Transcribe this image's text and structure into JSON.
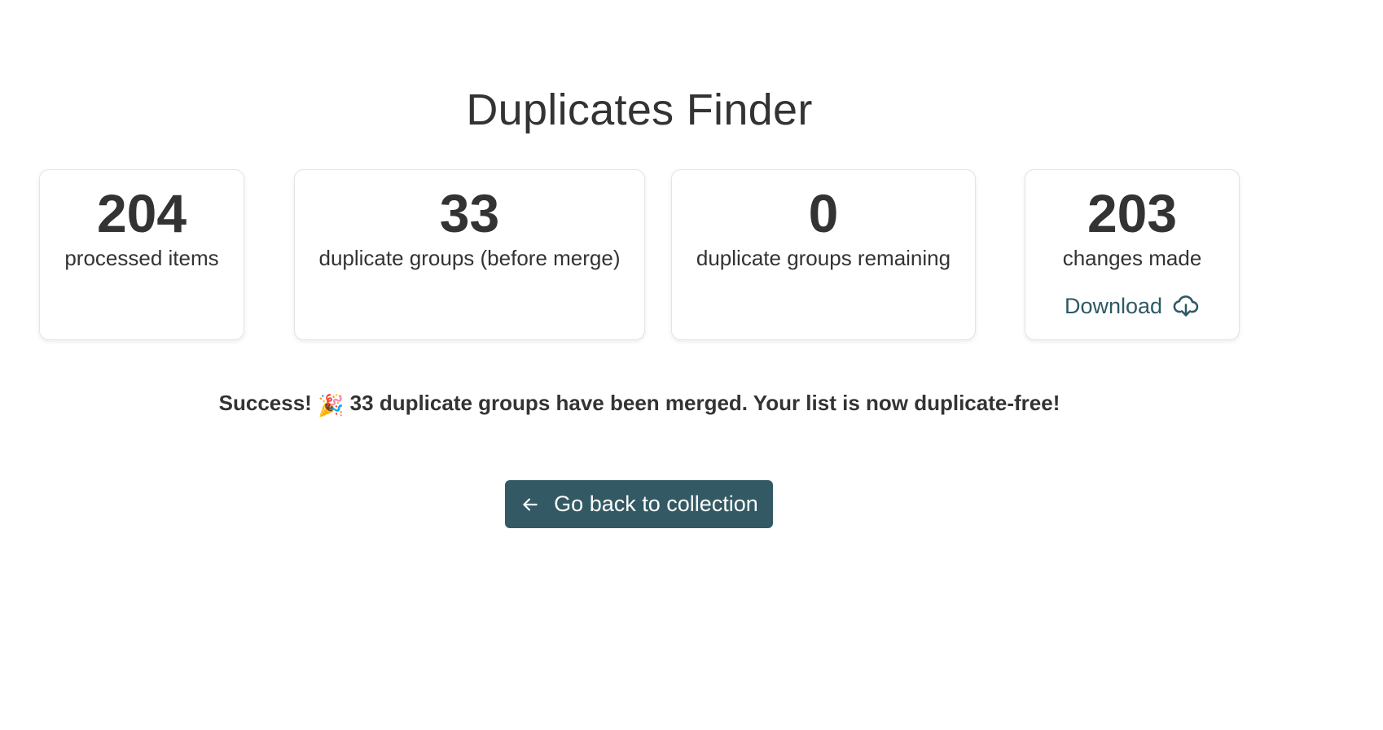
{
  "page": {
    "title": "Duplicates Finder"
  },
  "stats": [
    {
      "value": "204",
      "label": "processed items"
    },
    {
      "value": "33",
      "label": "duplicate groups (before merge)"
    },
    {
      "value": "0",
      "label": "duplicate groups remaining"
    },
    {
      "value": "203",
      "label": "changes made"
    }
  ],
  "download": {
    "label": "Download",
    "icon": "cloud-download-icon"
  },
  "message": {
    "lead": "Success!",
    "emoji": "🎉",
    "text": "33 duplicate groups have been merged. Your list is now duplicate-free!"
  },
  "back_button": {
    "label": "Go back to collection",
    "icon": "arrow-left-icon"
  },
  "colors": {
    "accent": "#335a64",
    "text": "#333333",
    "link": "#2d5964"
  }
}
